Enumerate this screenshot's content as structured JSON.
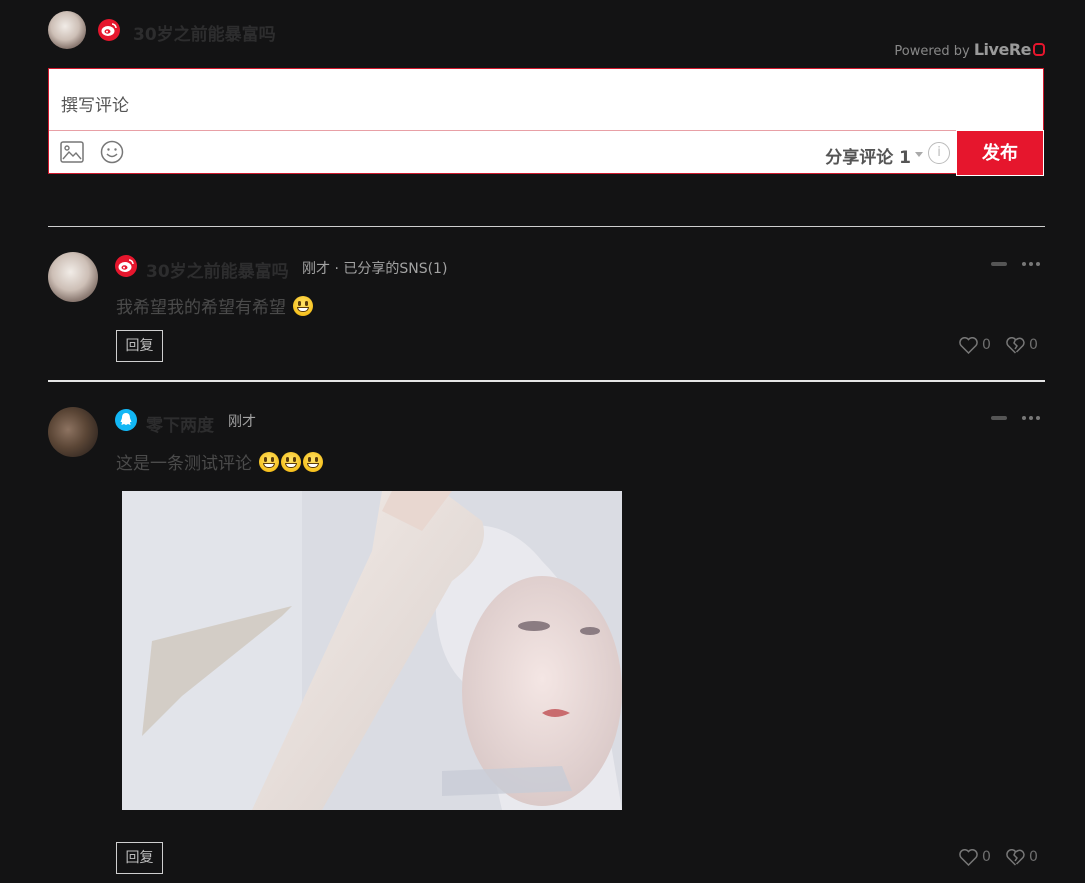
{
  "header": {
    "username": "30岁之前能暴富吗",
    "platform_icon": "weibo-icon",
    "powered_by_label": "Powered by",
    "powered_by_brand": "LiveRe"
  },
  "composer": {
    "placeholder": "撰写评论",
    "share_label": "分享评论 1",
    "info_symbol": "i",
    "post_label": "发布",
    "accent_color": "#e6162d"
  },
  "comments": [
    {
      "username": "30岁之前能暴富吗",
      "platform_icon": "weibo-icon",
      "meta": "刚才 · 已分享的SNS(1)",
      "text": "我希望我的希望有希望",
      "emoji_count": 1,
      "reply_label": "回复",
      "likes": "0",
      "dislikes": "0"
    },
    {
      "username": "零下两度",
      "platform_icon": "qq-icon",
      "meta": "刚才",
      "text": "这是一条测试评论",
      "emoji_count": 3,
      "has_image": true,
      "reply_label": "回复",
      "likes": "0",
      "dislikes": "0"
    }
  ]
}
